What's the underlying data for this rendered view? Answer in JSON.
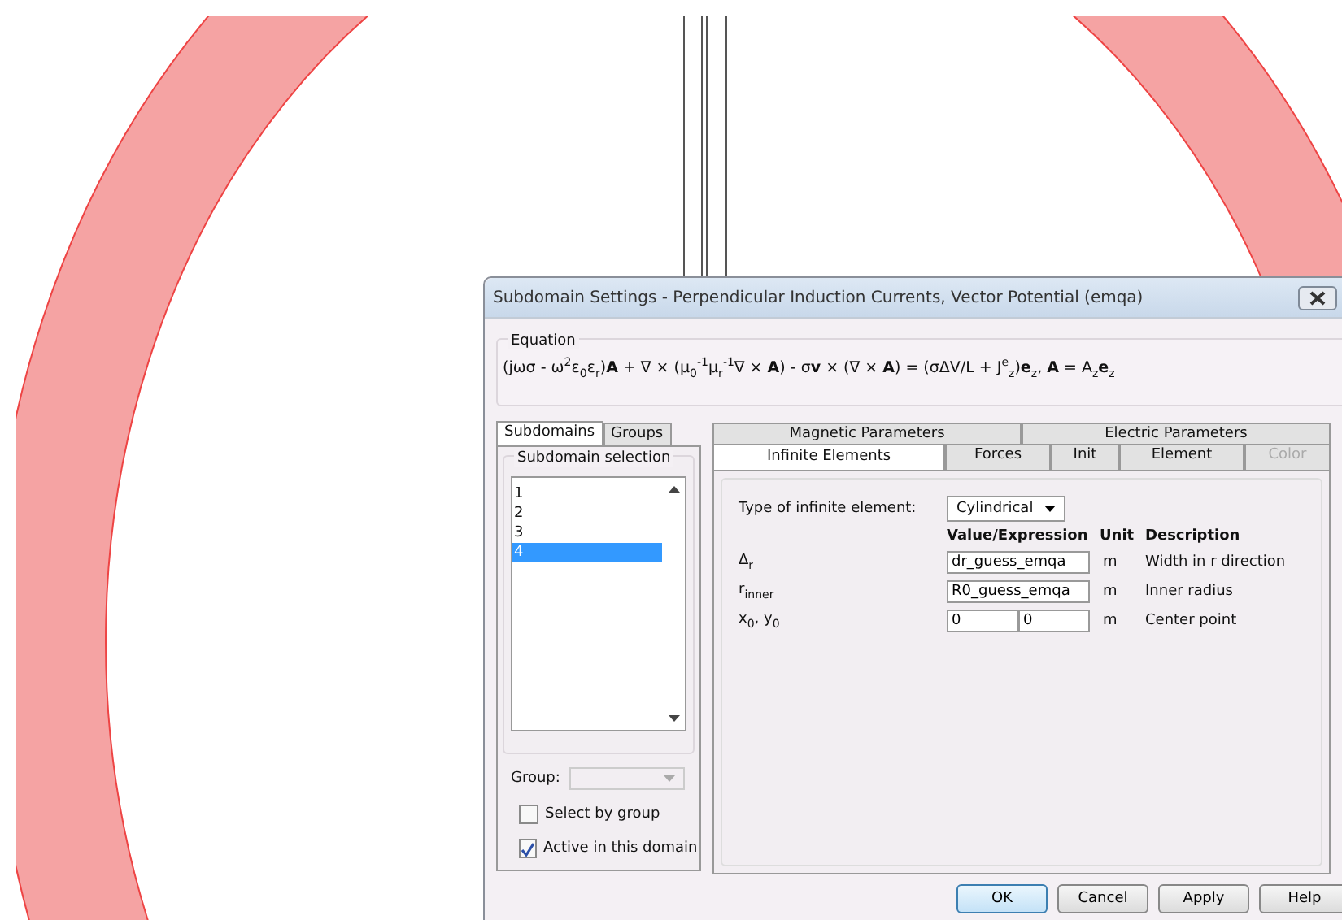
{
  "dialog": {
    "title": "Subdomain Settings - Perpendicular Induction Currents, Vector Potential (emqa)",
    "equation": {
      "label": "Equation",
      "text": "(jωσ - ω$^{2}$ε$_{0}$ε$_{r}$)**A** + ∇ × (μ$_{0}$$^{-1}$μ$_{r}$$^{-1}$∇ × **A**) - σ**v** × (∇ × **A**) = (σΔV/L + J$^{e}$$_{z}$)**e**$_{z}$, **A** = A$_{z}$**e**$_{z}$"
    },
    "left_tabs": [
      {
        "label": "Subdomains",
        "selected": true
      },
      {
        "label": "Groups",
        "selected": false
      }
    ],
    "subdomain_selection": {
      "label": "Subdomain selection",
      "items": [
        {
          "label": "1",
          "selected": false
        },
        {
          "label": "2",
          "selected": false
        },
        {
          "label": "3",
          "selected": false
        },
        {
          "label": "4",
          "selected": true
        }
      ]
    },
    "group": {
      "label": "Group:"
    },
    "checkboxes": [
      {
        "label": "Select by group",
        "checked": false
      },
      {
        "label": "Active in this domain",
        "checked": true
      }
    ],
    "right_tabs": [
      [
        {
          "label": "Magnetic Parameters",
          "selected": false,
          "disabled": false
        },
        {
          "label": "Electric Parameters",
          "selected": false,
          "disabled": false
        }
      ],
      [
        {
          "label": "Infinite Elements",
          "selected": true,
          "disabled": false
        },
        {
          "label": "Forces",
          "selected": false,
          "disabled": false
        },
        {
          "label": "Init",
          "selected": false,
          "disabled": false
        },
        {
          "label": "Element",
          "selected": false,
          "disabled": false
        },
        {
          "label": "Color",
          "selected": false,
          "disabled": true
        }
      ]
    ],
    "type_label": "Type of infinite element:",
    "type_value": "Cylindrical",
    "columns": [
      "Value/Expression",
      "Unit",
      "Description"
    ],
    "params": [
      {
        "symbol": "Δ$_{r}$",
        "values": [
          "dr_guess_emqa"
        ],
        "unit": "m",
        "description": "Width in r direction"
      },
      {
        "symbol": "r$_{inner}$",
        "values": [
          "R0_guess_emqa"
        ],
        "unit": "m",
        "description": "Inner radius"
      },
      {
        "symbol": "x$_{0}$, y$_{0}$",
        "values": [
          "0",
          "0"
        ],
        "unit": "m",
        "description": "Center point"
      }
    ],
    "buttons": [
      {
        "label": "OK",
        "default": true
      },
      {
        "label": "Cancel",
        "default": false
      },
      {
        "label": "Apply",
        "default": false
      },
      {
        "label": "Help",
        "default": false
      }
    ]
  }
}
